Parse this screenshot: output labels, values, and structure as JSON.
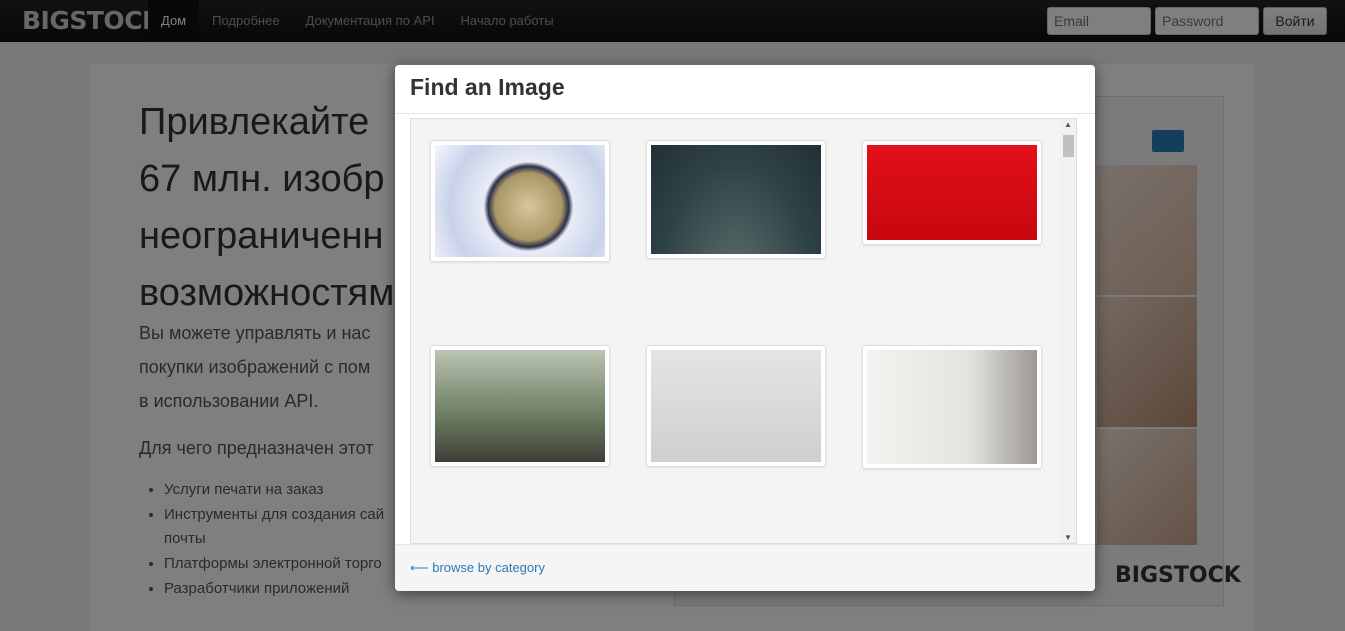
{
  "navbar": {
    "brand": "BIGSTOCK",
    "items": [
      {
        "label": "Дом",
        "active": true
      },
      {
        "label": "Подробнее",
        "active": false
      },
      {
        "label": "Документация по API",
        "active": false
      },
      {
        "label": "Начало работы",
        "active": false
      }
    ],
    "email_placeholder": "Email",
    "password_placeholder": "Password",
    "login_label": "Войти"
  },
  "page": {
    "hero_line1": "Привлекайте",
    "hero_line2": "67 млн. изобр",
    "hero_line3": "неограниченн",
    "hero_line4": "возможностям",
    "lead_line1": "Вы можете управлять и нас",
    "lead_line2": "покупки изображений с пом",
    "lead_line3": "в использовании API.",
    "subheading": "Для чего предназначен этот",
    "uses": [
      "Услуги печати на заказ",
      "Инструменты для создания сай",
      "почты",
      "Платформы электронной торго",
      "Разработчики приложений"
    ],
    "widget_brand": "BIGSTOCK"
  },
  "modal": {
    "title": "Find an Image",
    "back_link": "⟵ browse by category",
    "images": [
      {
        "name": "clock-2018-image",
        "bg": "radial-gradient(circle at 55% 55%,#d8c79a 0,#a99767 30%,#2b2f4a 36%,#e8ecf6 40%,#c9d2ea 70%,#f4f6fb 100%)"
      },
      {
        "name": "heart-image",
        "bg": "radial-gradient(ellipse at 50% 120%,#5c6b6b 0,#2f4346 60%,#213033 100%)"
      },
      {
        "name": "christmas-trees-image",
        "bg": "linear-gradient(#e3101b,#c8070f)"
      },
      {
        "name": "memorial-day-image",
        "bg": "linear-gradient(#b9c4b2,#6b7a5f 60%,#3d3f36)"
      },
      {
        "name": "gift-tree-image",
        "bg": "linear-gradient(#e4e4e4,#cfcfcf)"
      },
      {
        "name": "mother-child-flowers-image",
        "bg": "linear-gradient(90deg,#f2f3f0,#e3e3df 60%,#9c9892)"
      }
    ]
  }
}
